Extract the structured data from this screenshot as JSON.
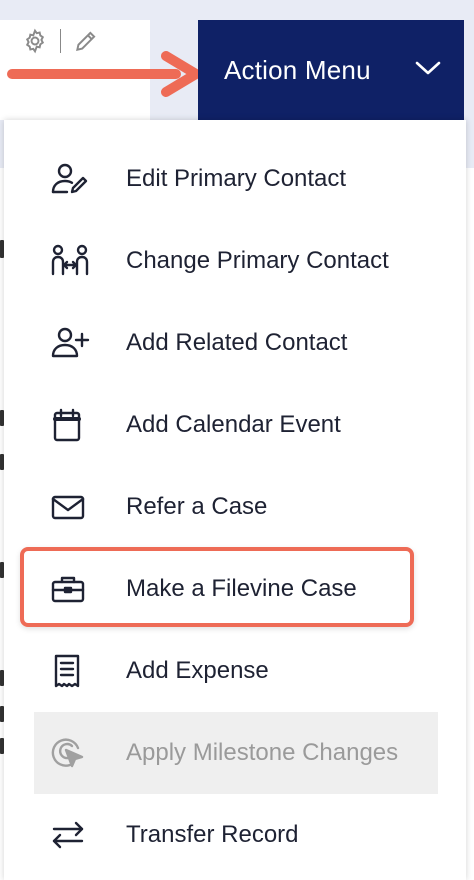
{
  "header": {
    "action_menu_label": "Action Menu"
  },
  "menu": {
    "items": [
      {
        "label": "Edit Primary Contact",
        "icon": "user-edit-icon",
        "enabled": true
      },
      {
        "label": "Change Primary Contact",
        "icon": "users-swap-icon",
        "enabled": true
      },
      {
        "label": "Add Related Contact",
        "icon": "user-plus-icon",
        "enabled": true
      },
      {
        "label": "Add Calendar Event",
        "icon": "calendar-icon",
        "enabled": true
      },
      {
        "label": "Refer a Case",
        "icon": "envelope-icon",
        "enabled": true
      },
      {
        "label": "Make a Filevine Case",
        "icon": "briefcase-icon",
        "enabled": true,
        "highlighted": true
      },
      {
        "label": "Add Expense",
        "icon": "receipt-icon",
        "enabled": true
      },
      {
        "label": "Apply Milestone Changes",
        "icon": "target-cursor-icon",
        "enabled": false
      },
      {
        "label": "Transfer Record",
        "icon": "transfer-arrows-icon",
        "enabled": true
      }
    ]
  },
  "colors": {
    "header_bg": "#0f2166",
    "annotation": "#ee6b56",
    "disabled_bg": "#efefef"
  }
}
